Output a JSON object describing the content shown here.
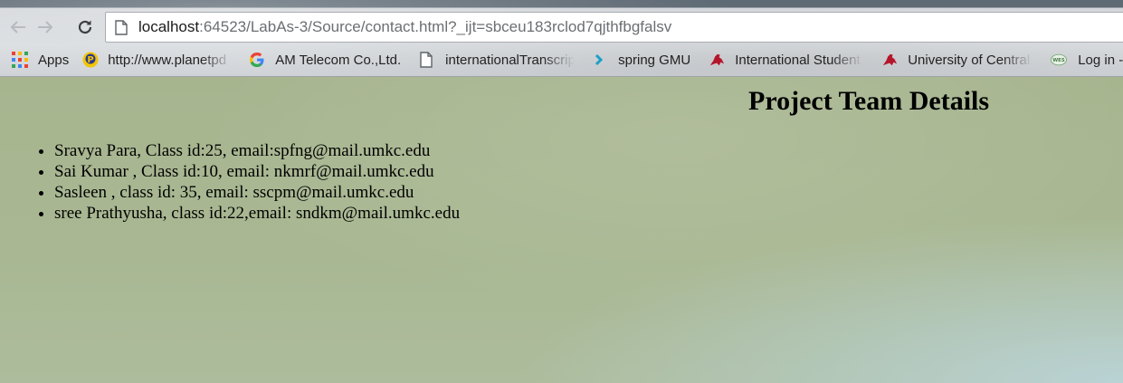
{
  "browser": {
    "url_host": "localhost",
    "url_path": ":64523/LabAs-3/Source/contact.html?_ijt=sbceu183rclod7qjthfbgfalsv",
    "bookmarks": [
      {
        "label": "Apps",
        "icon": "apps-grid-icon"
      },
      {
        "label": "http://www.planetpd",
        "icon": "planet-p-icon"
      },
      {
        "label": "AM Telecom Co.,Ltd.",
        "icon": "google-g-icon"
      },
      {
        "label": "internationalTranscrip",
        "icon": "page-icon"
      },
      {
        "label": "spring GMU",
        "icon": "chevron-icon"
      },
      {
        "label": "International Student",
        "icon": "kangaroo-icon"
      },
      {
        "label": "University of Central",
        "icon": "mule-icon"
      },
      {
        "label": "Log in - W",
        "icon": "wes-icon"
      }
    ]
  },
  "page": {
    "title": "Project Team Details",
    "members": [
      "Sravya Para, Class id:25, email:spfng@mail.umkc.edu",
      "Sai Kumar , Class id:10, email: nkmrf@mail.umkc.edu",
      "Sasleen , class id: 35, email: sscpm@mail.umkc.edu",
      "sree Prathyusha, class id:22,email: sndkm@mail.umkc.edu"
    ]
  }
}
